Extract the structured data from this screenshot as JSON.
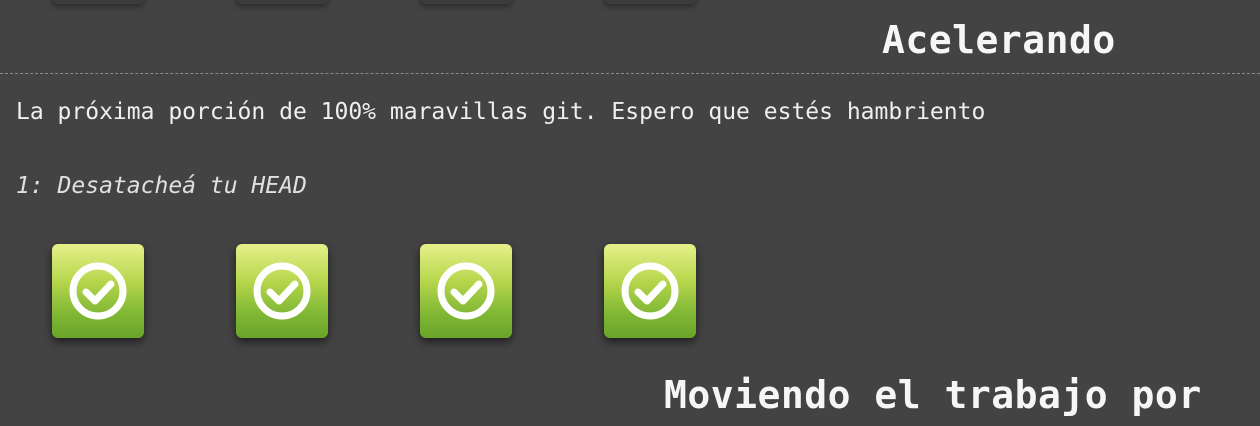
{
  "section": {
    "title": "Acelerando",
    "description": "La próxima porción de 100% maravillas git. Espero que estés hambriento",
    "level_name": "1: Desatacheá tu HEAD",
    "levels": [
      {
        "status": "completed",
        "icon": "check-circle-icon"
      },
      {
        "status": "completed",
        "icon": "check-circle-icon"
      },
      {
        "status": "completed",
        "icon": "check-circle-icon"
      },
      {
        "status": "completed",
        "icon": "check-circle-icon"
      }
    ]
  },
  "next_section": {
    "title": "Moviendo el trabajo por"
  },
  "colors": {
    "background": "#434343",
    "tile_top": "#e6f08a",
    "tile_bottom": "#6aa52a",
    "check_icon": "#ffffff"
  }
}
